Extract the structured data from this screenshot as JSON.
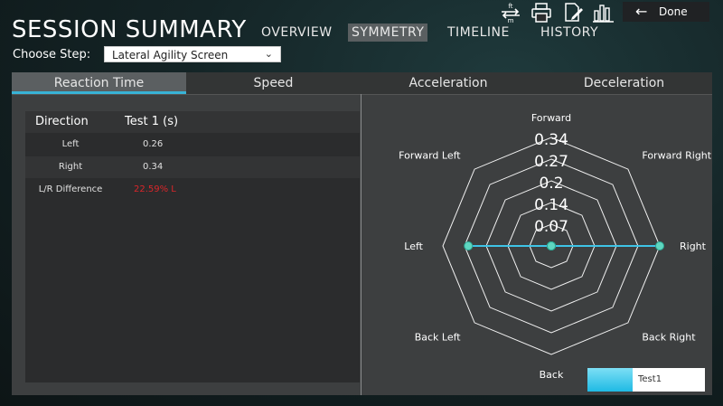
{
  "header": {
    "title": "SESSION SUMMARY",
    "nav": [
      "OVERVIEW",
      "SYMMETRY",
      "TIMELINE",
      "HISTORY"
    ],
    "active_nav": "SYMMETRY",
    "toolbar_icons": [
      "units-toggle-icon",
      "print-icon",
      "edit-notes-icon",
      "bar-chart-icon"
    ],
    "units_icon_top": "ft",
    "units_icon_bottom": "m",
    "done_label": "Done"
  },
  "step": {
    "label": "Choose Step:",
    "selected": "Lateral Agility Screen"
  },
  "tabs": [
    "Reaction Time",
    "Speed",
    "Acceleration",
    "Deceleration"
  ],
  "active_tab": "Reaction Time",
  "table": {
    "headers": [
      "Direction",
      "Test 1 (s)"
    ],
    "rows": [
      {
        "direction": "Left",
        "value": "0.26"
      },
      {
        "direction": "Right",
        "value": "0.34"
      },
      {
        "direction": "L/R Difference",
        "value": "22.59% L"
      }
    ],
    "difference_color": "#d9262a"
  },
  "chart_data": {
    "type": "radar",
    "axes": [
      "Forward",
      "Forward Right",
      "Right",
      "Back Right",
      "Back",
      "Back Left",
      "Left",
      "Forward Left"
    ],
    "ticks": [
      "0.07",
      "0.14",
      "0.2",
      "0.27",
      "0.34"
    ],
    "rmax": 0.34,
    "series": [
      {
        "name": "Test1",
        "color": "#3ec3e6",
        "values": [
          0,
          0,
          0.34,
          0,
          0,
          0,
          0.26,
          0
        ]
      }
    ]
  },
  "legend": {
    "label": "Test1"
  }
}
